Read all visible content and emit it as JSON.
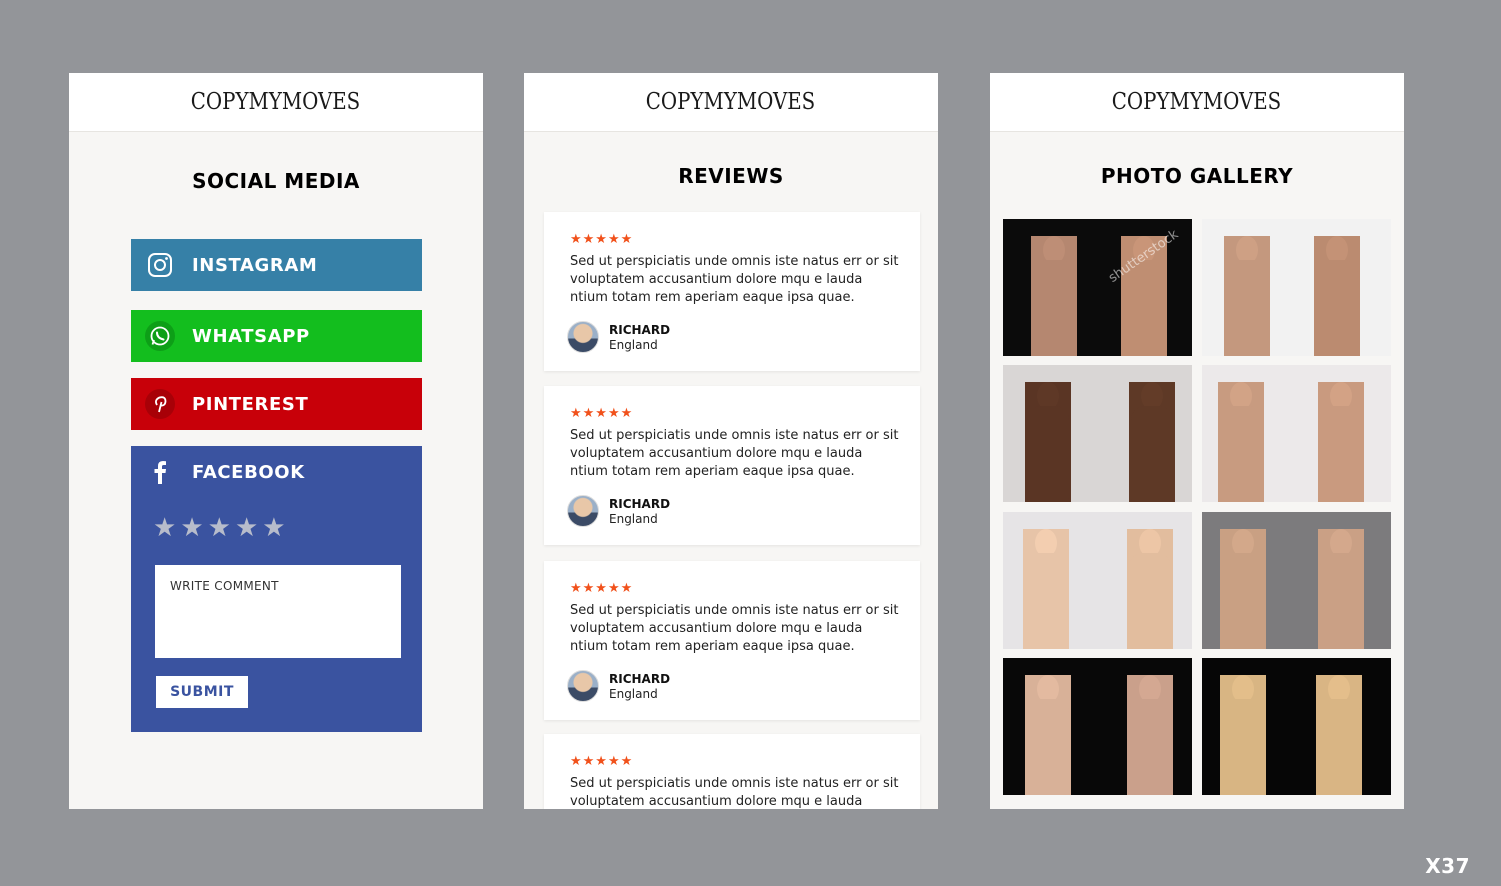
{
  "logo": "COPYMYMOVES",
  "social": {
    "title": "SOCIAL MEDIA",
    "buttons": [
      "INSTAGRAM",
      "WHATSAPP",
      "PINTEREST",
      "FACEBOOK"
    ],
    "rating_stars": 5,
    "comment_placeholder": "WRITE COMMENT",
    "submit": "SUBMIT",
    "colors": {
      "instagram": "#3680a7",
      "whatsapp": "#13be1e",
      "pinterest": "#c80009",
      "facebook": "#3a53a0"
    }
  },
  "reviews": {
    "title": "REVIEWS",
    "stars": "★★★★★",
    "items": [
      {
        "text": "Sed ut perspiciatis unde omnis iste natus err or sit voluptatem accusantium dolore mqu e lauda ntium totam rem aperiam eaque ipsa quae.",
        "name": "RICHARD",
        "location": "England"
      },
      {
        "text": "Sed ut perspiciatis unde omnis iste natus err or sit voluptatem accusantium dolore mqu e lauda ntium totam rem aperiam eaque ipsa quae.",
        "name": "RICHARD",
        "location": "England"
      },
      {
        "text": "Sed ut perspiciatis unde omnis iste natus err or sit voluptatem accusantium dolore mqu e lauda ntium totam rem aperiam eaque ipsa quae.",
        "name": "RICHARD",
        "location": "England"
      },
      {
        "text": "Sed ut perspiciatis unde omnis iste natus err or sit voluptatem accusantium dolore mqu e lauda ntium",
        "name": "",
        "location": ""
      }
    ]
  },
  "gallery": {
    "title": "PHOTO GALLERY",
    "watermark": "shutterstock"
  },
  "badge": "X37"
}
